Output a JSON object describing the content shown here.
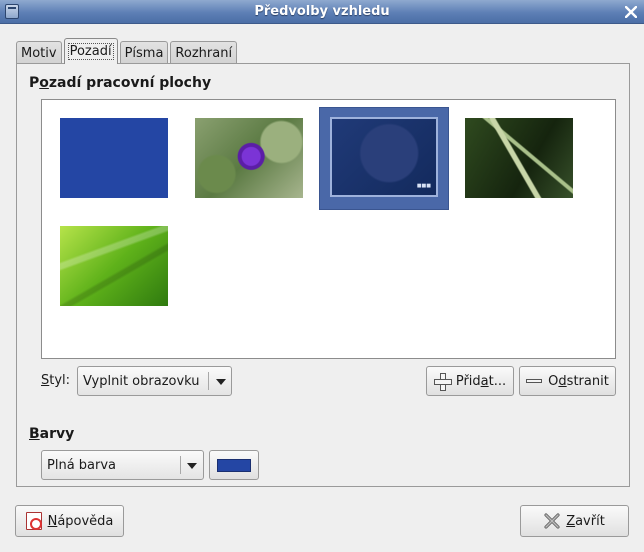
{
  "window": {
    "title": "Předvolby vzhledu"
  },
  "tabs": [
    {
      "label": "Motiv"
    },
    {
      "label": "Pozadí"
    },
    {
      "label": "Písma"
    },
    {
      "label": "Rozhraní"
    }
  ],
  "background": {
    "section_title_a": "P",
    "section_title_u": "o",
    "section_title_b": "zadí pracovní plochy",
    "thumbnails": [
      "solid-blue",
      "purple-flower",
      "fedora-dark-blue",
      "fern",
      "green-leaf"
    ],
    "style_label_u": "S",
    "style_label_b": "tyl:",
    "style_value": "Vyplnit obrazovku",
    "add_button_a": "Přid",
    "add_button_u": "a",
    "add_button_b": "t...",
    "remove_button_a": "O",
    "remove_button_u": "d",
    "remove_button_b": "stranit"
  },
  "colors": {
    "section_title_u": "B",
    "section_title_b": "arvy",
    "mode_value": "Plná barva",
    "swatch_color": "#2446a4"
  },
  "footer": {
    "help_button_u": "N",
    "help_button_b": "ápověda",
    "close_button_u": "Z",
    "close_button_b": "avřít"
  },
  "icons": {
    "add": "plus-icon",
    "remove": "minus-icon",
    "help": "help-icon",
    "close": "x-icon"
  }
}
